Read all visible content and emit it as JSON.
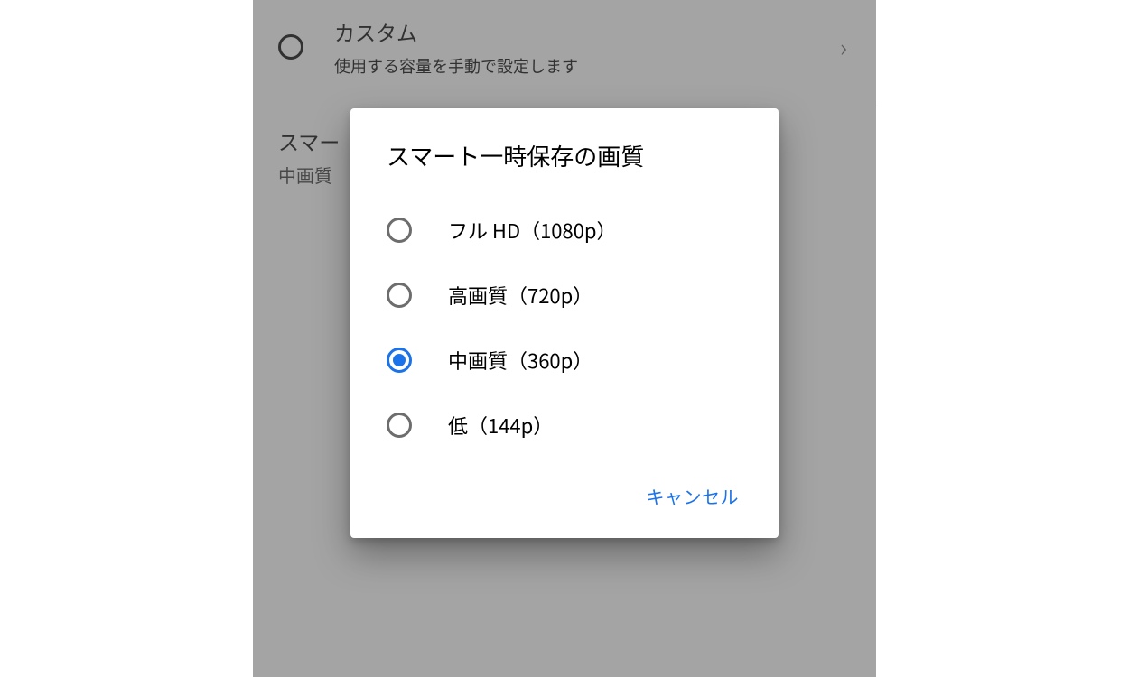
{
  "background": {
    "custom": {
      "title": "カスタム",
      "subtitle": "使用する容量を手動で設定します"
    },
    "section": {
      "title_visible": "スマー",
      "value": "中画質"
    }
  },
  "dialog": {
    "title": "スマート一時保存の画質",
    "options": [
      {
        "label": "フル HD（1080p）",
        "selected": false
      },
      {
        "label": "高画質（720p）",
        "selected": false
      },
      {
        "label": "中画質（360p）",
        "selected": true
      },
      {
        "label": "低（144p）",
        "selected": false
      }
    ],
    "cancel": "キャンセル"
  },
  "colors": {
    "accent": "#1a73e8",
    "overlay": "rgba(90,90,90,0.55)"
  }
}
